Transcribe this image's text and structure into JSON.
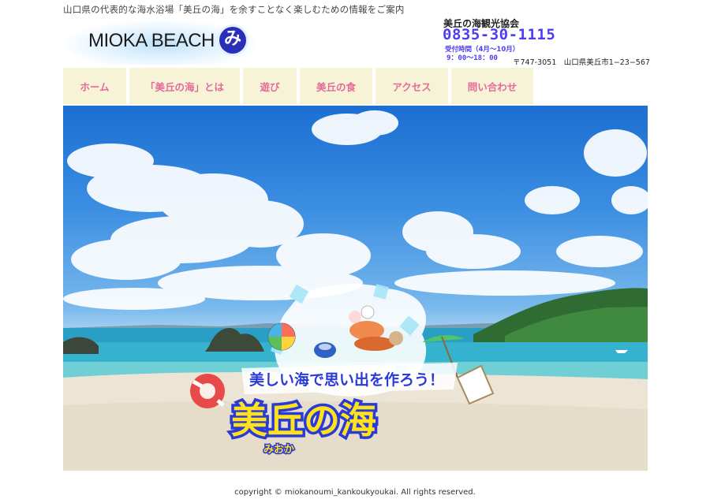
{
  "header": {
    "tagline": "山口県の代表的な海水浴場「美丘の海」を余すことなく楽しむための情報をご案内",
    "logo_text": "MIOKA BEACH",
    "logo_badge": "み"
  },
  "contact": {
    "org_name": "美丘の海観光協会",
    "phone": "0835-30-1115",
    "hours_label": "受付時間（4月〜10月）",
    "hours_time": "9：00〜18：00",
    "address": "〒747-3051　山口県美丘市1−23−567"
  },
  "nav": {
    "items": [
      {
        "label": "ホーム"
      },
      {
        "label": "「美丘の海」とは"
      },
      {
        "label": "遊び"
      },
      {
        "label": "美丘の食"
      },
      {
        "label": "アクセス"
      },
      {
        "label": "問い合わせ"
      }
    ]
  },
  "hero": {
    "catch_copy": "美しい海で思い出を作ろう！",
    "title": "美丘の海",
    "title_reading": "みおか"
  },
  "footer": {
    "copyright": "copyright © miokanoumi_kankoukyoukai. All rights reserved."
  },
  "colors": {
    "nav_bg": "#f7f3d6",
    "nav_text": "#e46a9b",
    "phone": "#4d3df2",
    "title_yellow": "#ffe21a",
    "catch_blue": "#2a3ad8"
  }
}
